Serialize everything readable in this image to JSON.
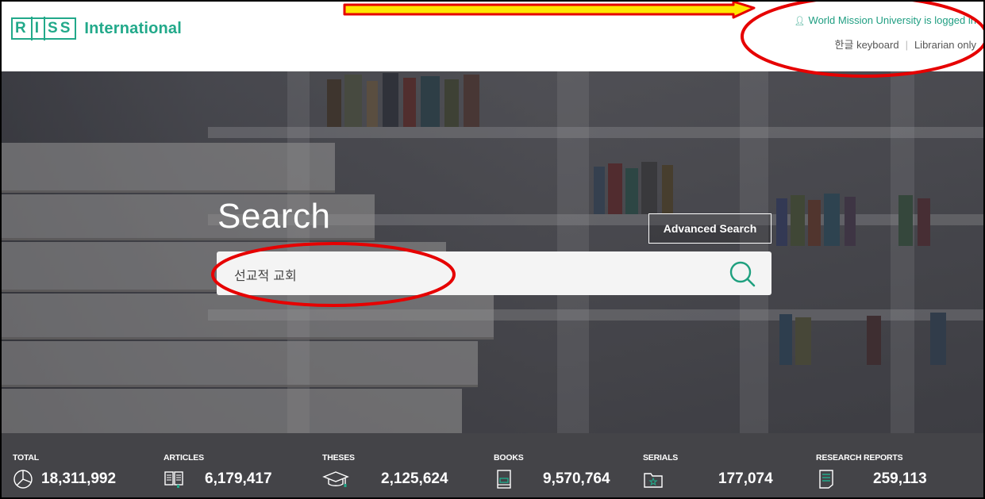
{
  "header": {
    "logo_letters": "RISS",
    "logo_text": "International",
    "user_status": "World Mission University is logged in",
    "links": [
      "한글 keyboard",
      "Librarian only"
    ]
  },
  "search": {
    "title": "Search",
    "advanced_label": "Advanced Search",
    "query": "선교적 교회"
  },
  "stats": [
    {
      "label": "TOTAL",
      "value": "18,311,992",
      "icon": "pie-chart-icon"
    },
    {
      "label": "ARTICLES",
      "value": "6,179,417",
      "icon": "open-book-icon"
    },
    {
      "label": "THESES",
      "value": "2,125,624",
      "icon": "graduation-cap-icon"
    },
    {
      "label": "BOOKS",
      "value": "9,570,764",
      "icon": "book-icon"
    },
    {
      "label": "SERIALS",
      "value": "177,074",
      "icon": "folder-star-icon"
    },
    {
      "label": "RESEARCH REPORTS",
      "value": "259,113",
      "icon": "document-icon"
    }
  ],
  "colors": {
    "brand": "#22a98a",
    "annotation_red": "#e60000",
    "annotation_yellow": "#ffe600",
    "stats_bar": "#3a3a3e"
  }
}
